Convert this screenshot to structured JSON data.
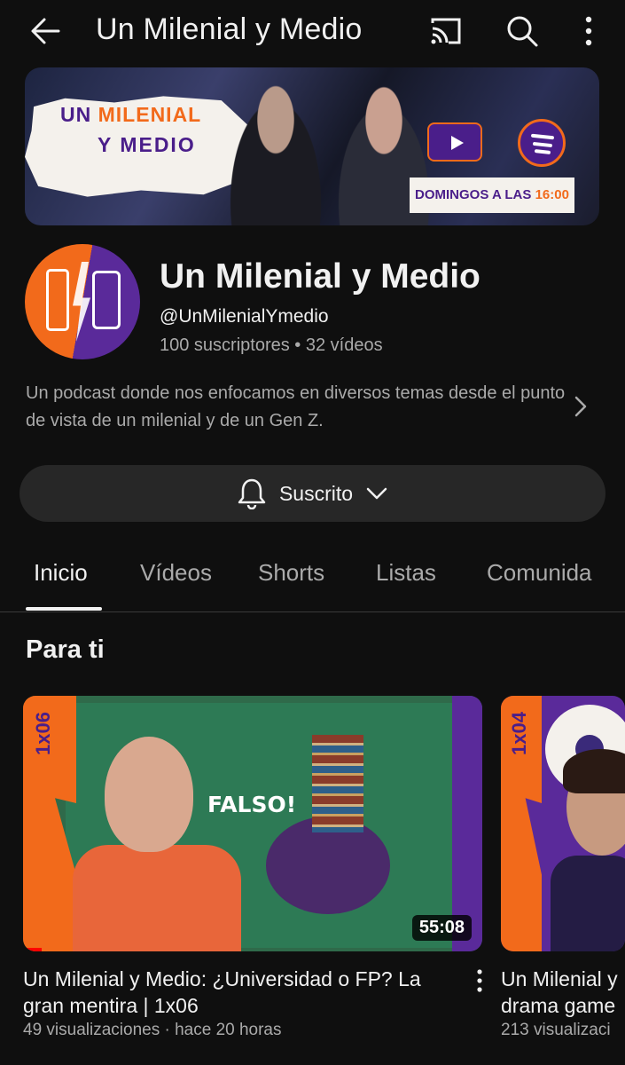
{
  "header": {
    "title": "Un Milenial y Medio",
    "icons": [
      "back-arrow-icon",
      "cast-icon",
      "search-icon",
      "more-vert-icon"
    ]
  },
  "banner": {
    "line1_a": "UN ",
    "line1_b": "MILENIAL",
    "line2": "Y  MEDIO",
    "schedule_a": "DOMINGOS A LAS ",
    "schedule_b": "16:00"
  },
  "channel": {
    "name": "Un Milenial y Medio",
    "handle": "@UnMilenialYmedio",
    "stats": "100 suscriptores • 32 vídeos",
    "description": "Un podcast donde nos enfocamos en diversos temas desde el punto de vista de un milenial y de un Gen Z."
  },
  "subscribe": {
    "label": "Suscrito"
  },
  "tabs": [
    {
      "label": "Inicio",
      "active": true
    },
    {
      "label": "Vídeos"
    },
    {
      "label": "Shorts"
    },
    {
      "label": "Listas"
    },
    {
      "label": "Comunida"
    }
  ],
  "section": {
    "title": "Para ti"
  },
  "videos": [
    {
      "episode": "1x06",
      "thumb_text": "FALSO!",
      "duration": "55:08",
      "watched_fraction": 0.04,
      "title_line1": "Un Milenial y Medio: ¿Universidad o FP? La",
      "title_line2": "gran mentira | 1x06",
      "meta": "49 visualizaciones · hace 20 horas"
    },
    {
      "episode": "1x04",
      "title_line1": "Un Milenial y",
      "title_line2": "drama game",
      "meta": "213 visualizaci"
    }
  ],
  "colors": {
    "background": "#0f0f0f",
    "brand_orange": "#f26a1b",
    "brand_purple": "#5a2a9a",
    "progress": "#ff0000"
  }
}
